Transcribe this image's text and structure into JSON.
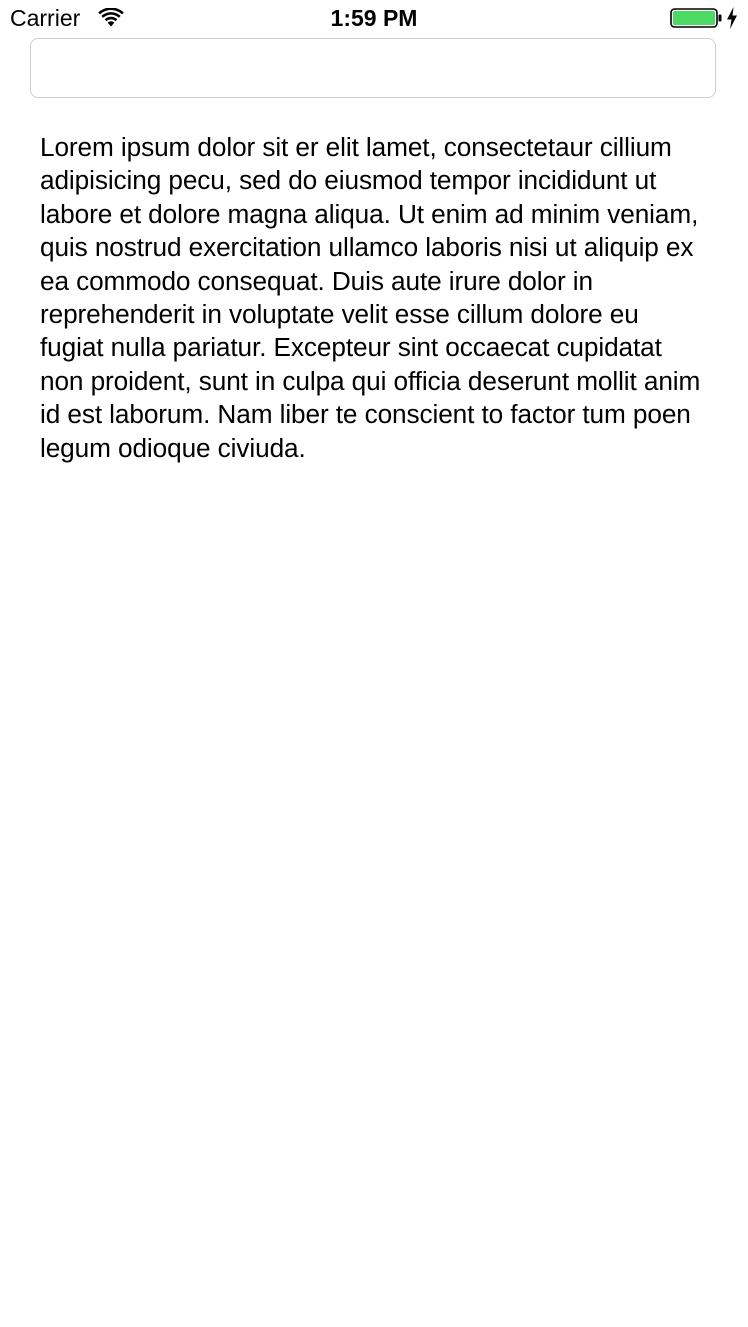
{
  "status_bar": {
    "carrier": "Carrier",
    "time": "1:59 PM",
    "wifi_icon": "wifi-icon",
    "battery_icon": "battery-icon",
    "charging_icon": "charging-bolt-icon",
    "battery_level": 1.0,
    "battery_color": "#4cd964"
  },
  "search": {
    "value": "",
    "placeholder": ""
  },
  "content": {
    "paragraph": "Lorem ipsum dolor sit er elit lamet, consectetaur cillium adipisicing pecu, sed do eiusmod tempor incididunt ut labore et dolore magna aliqua. Ut enim ad minim veniam, quis nostrud exercitation ullamco laboris nisi ut aliquip ex ea commodo consequat. Duis aute irure dolor in reprehenderit in voluptate velit esse cillum dolore eu fugiat nulla pariatur. Excepteur sint occaecat cupidatat non proident, sunt in culpa qui officia deserunt mollit anim id est laborum. Nam liber te conscient to factor tum poen legum odioque civiuda."
  }
}
